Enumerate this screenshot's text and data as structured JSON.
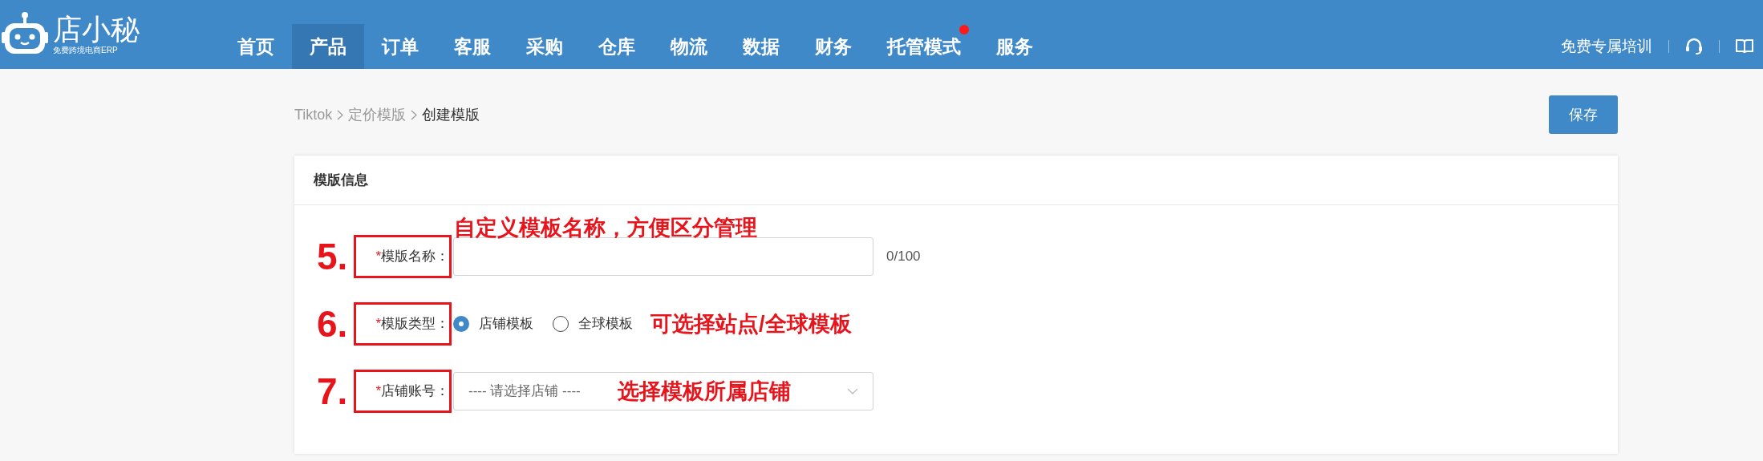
{
  "header": {
    "logo": {
      "name": "店小秘",
      "tagline": "免费跨境电商ERP"
    },
    "nav": [
      {
        "label": "首页",
        "selected": false,
        "badge": false
      },
      {
        "label": "产品",
        "selected": true,
        "badge": false
      },
      {
        "label": "订单",
        "selected": false,
        "badge": false
      },
      {
        "label": "客服",
        "selected": false,
        "badge": false
      },
      {
        "label": "采购",
        "selected": false,
        "badge": false
      },
      {
        "label": "仓库",
        "selected": false,
        "badge": false
      },
      {
        "label": "物流",
        "selected": false,
        "badge": false
      },
      {
        "label": "数据",
        "selected": false,
        "badge": false
      },
      {
        "label": "财务",
        "selected": false,
        "badge": false
      },
      {
        "label": "托管模式",
        "selected": false,
        "badge": true
      },
      {
        "label": "服务",
        "selected": false,
        "badge": false
      }
    ],
    "training_link": "免费专属培训"
  },
  "breadcrumb": [
    {
      "label": "Tiktok",
      "current": false
    },
    {
      "label": "定价模版",
      "current": false
    },
    {
      "label": "创建模版",
      "current": true
    }
  ],
  "save_button": "保存",
  "card": {
    "title": "模版信息",
    "fields": [
      {
        "kind": "text",
        "step": "5.",
        "label": "模版名称：",
        "required_mark": "*",
        "counter": "0/100",
        "annotation": "自定义模板名称，方便区分管理"
      },
      {
        "kind": "radio",
        "step": "6.",
        "label": "模版类型：",
        "required_mark": "*",
        "options": [
          {
            "label": "店铺模板",
            "selected": true
          },
          {
            "label": "全球模板",
            "selected": false
          }
        ],
        "annotation": "可选择站点/全球模板"
      },
      {
        "kind": "select",
        "step": "7.",
        "label": "店铺账号：",
        "required_mark": "*",
        "placeholder": "---- 请选择店铺 ----",
        "annotation": "选择模板所属店铺"
      }
    ]
  }
}
